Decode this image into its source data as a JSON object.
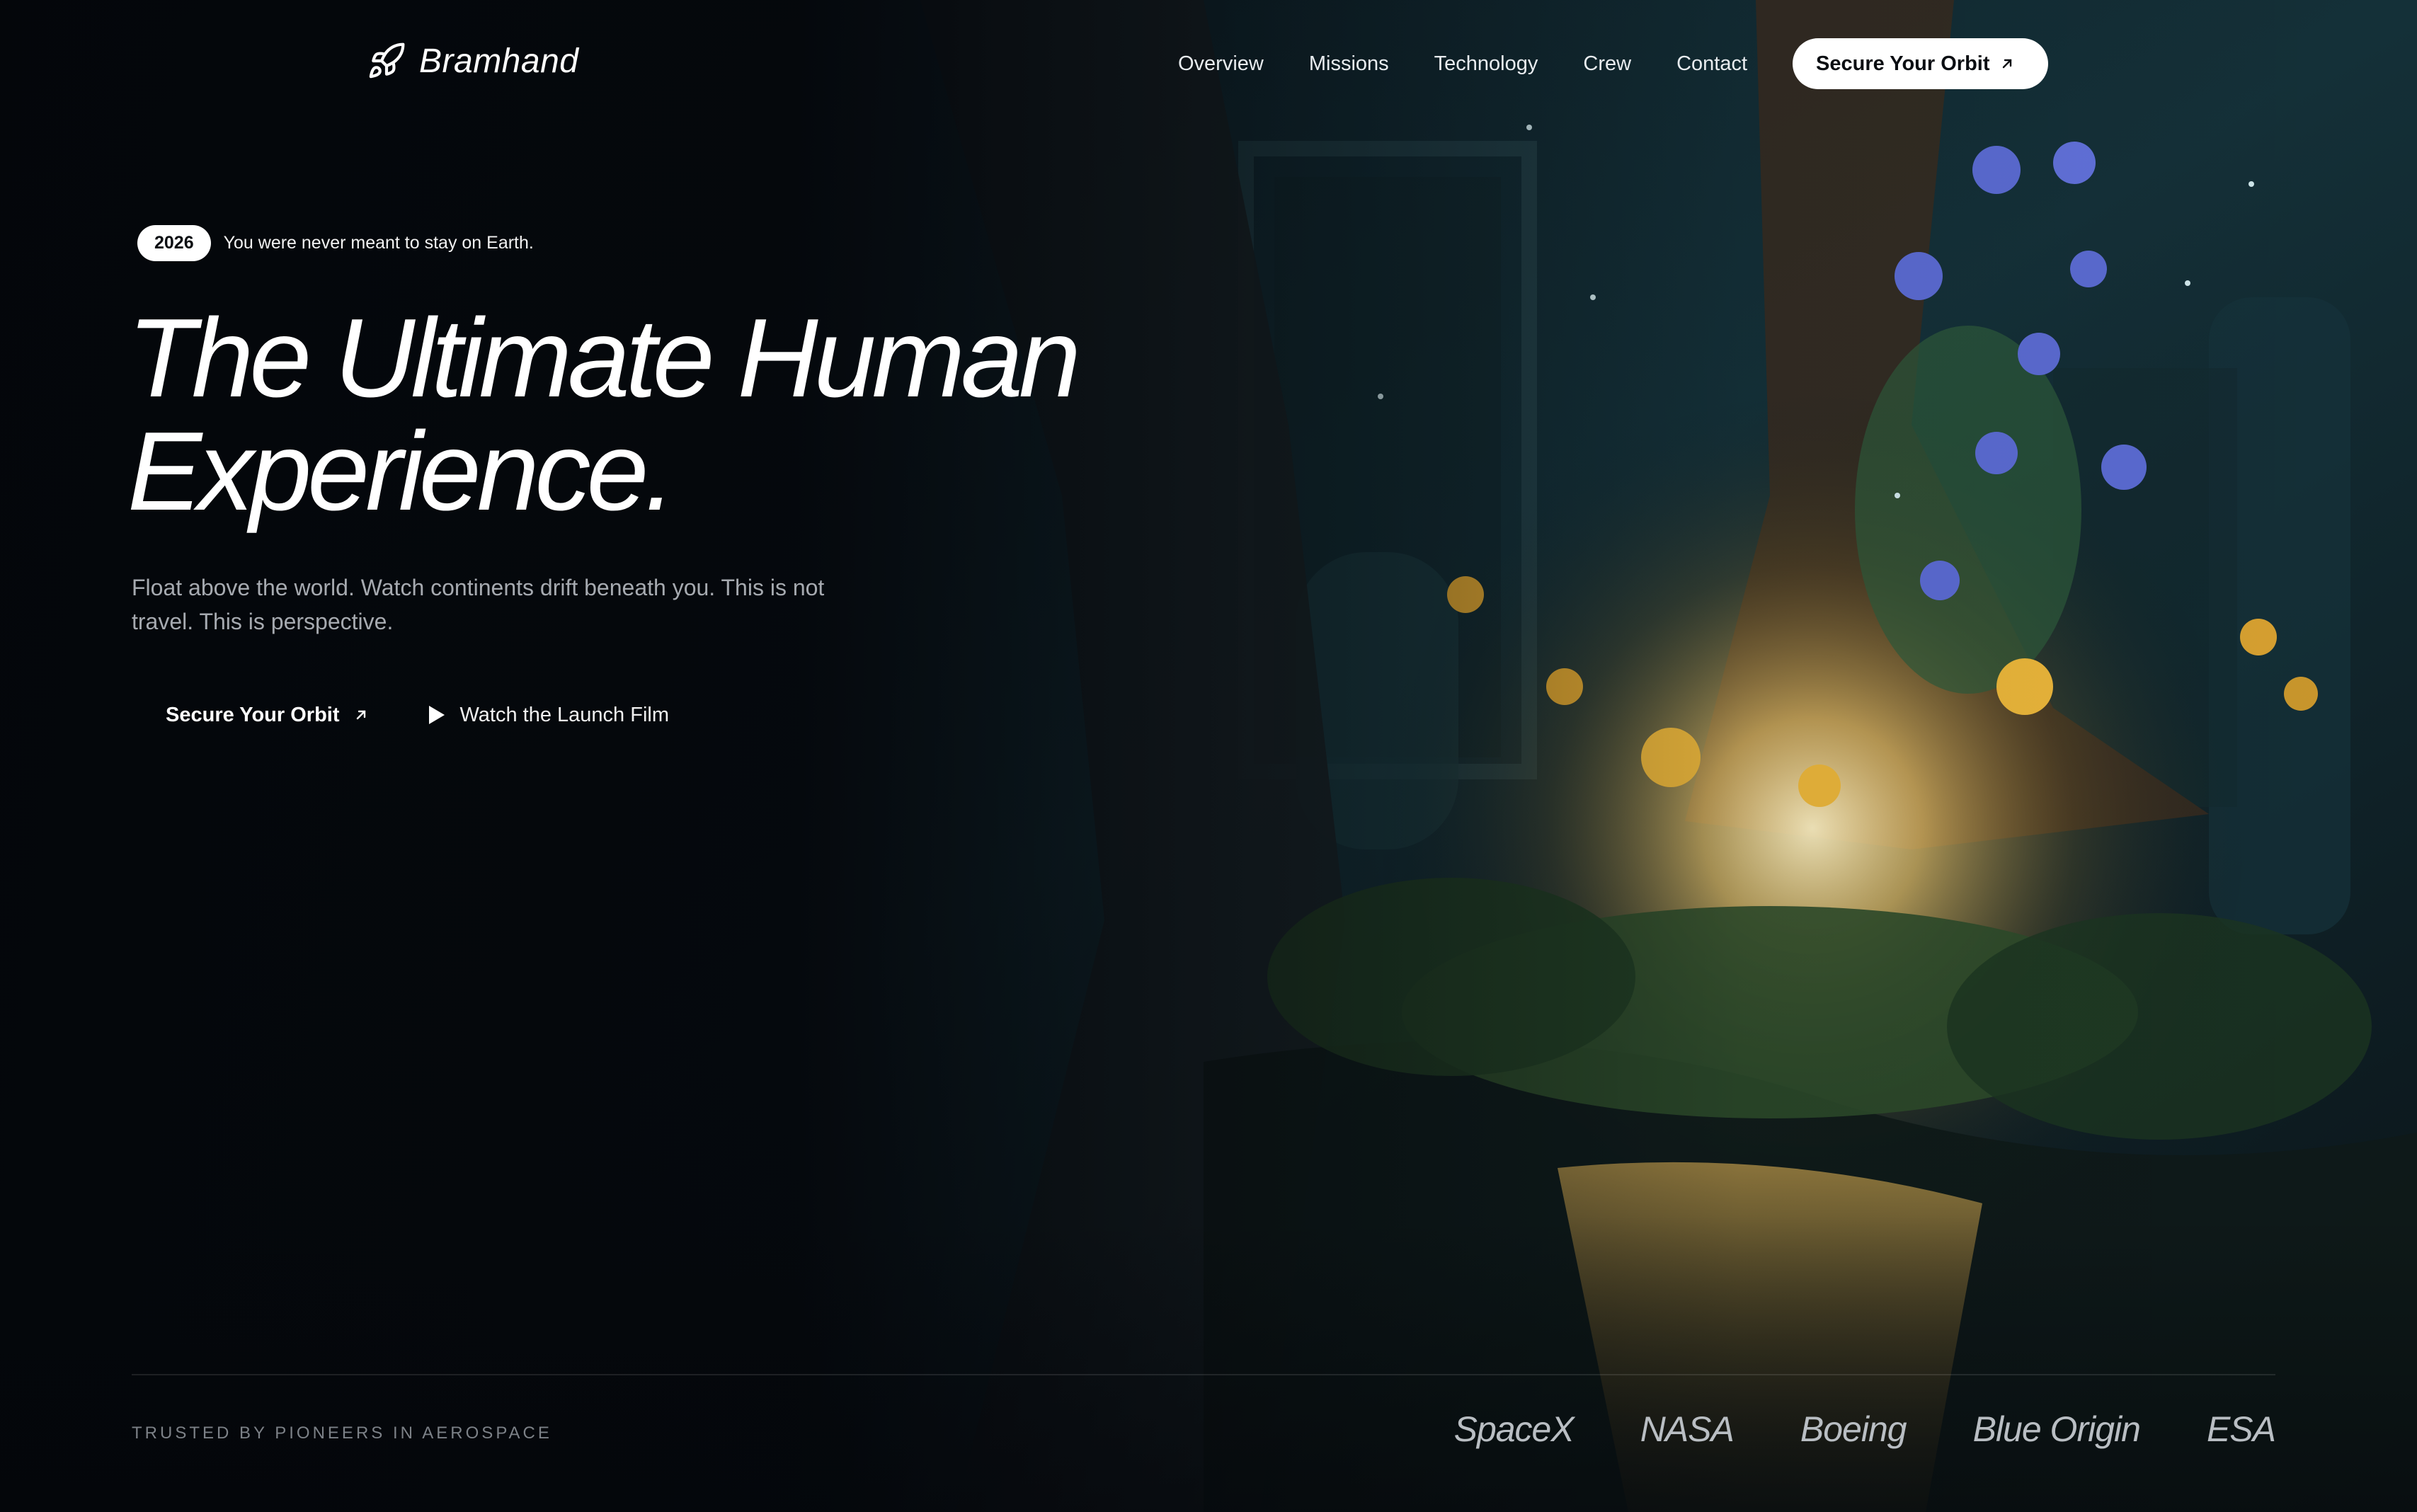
{
  "brand": {
    "name": "Bramhand",
    "icon": "rocket-icon"
  },
  "nav": {
    "items": [
      "Overview",
      "Missions",
      "Technology",
      "Crew",
      "Contact"
    ],
    "cta_label": "Secure Your Orbit",
    "cta_icon": "arrow-up-right-icon"
  },
  "hero": {
    "badge": "2026",
    "badge_text": "You were never meant to stay on Earth.",
    "headline_line1": "The Ultimate Human",
    "headline_line2": "Experience.",
    "subtext": "Float above the world. Watch continents drift beneath you. This is not travel. This is perspective.",
    "primary_cta": "Secure Your Orbit",
    "primary_cta_icon": "arrow-up-right-icon",
    "secondary_cta": "Watch the Launch Film",
    "secondary_cta_icon": "play-icon"
  },
  "trust": {
    "label": "TRUSTED BY PIONEERS IN AEROSPACE",
    "partners": [
      "SpaceX",
      "NASA",
      "Boeing",
      "Blue Origin",
      "ESA"
    ]
  },
  "colors": {
    "background": "#05080c",
    "text": "#ffffff",
    "muted_text": "#a6aab0",
    "accent_glow": "#f4c96a"
  }
}
